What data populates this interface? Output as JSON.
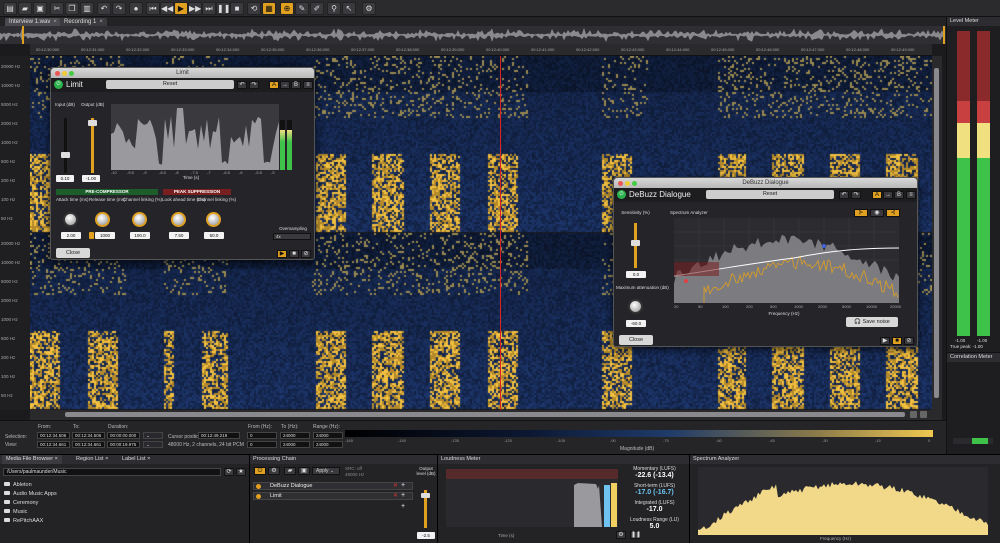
{
  "tabs": [
    {
      "label": "Interview 1.wav"
    },
    {
      "label": "Recording 1"
    }
  ],
  "timeline_ticks": [
    "00:12:30.000",
    "00:12:31.000",
    "00:12:32.000",
    "00:12:33.000",
    "00:12:34.000",
    "00:12:35.000",
    "00:12:36.000",
    "00:12:37.000",
    "00:12:38.000",
    "00:12:39.000",
    "00:12:40.000",
    "00:12:41.000",
    "00:12:42.000",
    "00:12:43.000",
    "00:12:44.000",
    "00:12:45.000",
    "00:12:46.000",
    "00:12:47.000",
    "00:12:48.000",
    "00:12:49.000"
  ],
  "freq_labels": [
    "20000 Hz",
    "10000 Hz",
    "5000 Hz",
    "2000 Hz",
    "1000 Hz",
    "500 Hz",
    "200 Hz",
    "100 Hz",
    "50 Hz"
  ],
  "info": {
    "selection": "Selection:",
    "view": "View:",
    "from_label": "From:",
    "to_label": "To:",
    "duration_label": "Duration:",
    "sel_from": "00:12:34.506",
    "sel_to": "00:12:34.506",
    "sel_dur": "00:00:00.000",
    "view_from": "00:12:34.661",
    "view_to": "00:12:34.661",
    "view_dur": "00:00:19.975",
    "cursor_label": "Cursor position:",
    "cursor_val": "00:12:49.219",
    "format": "48000 Hz, 2 channels, 24 bit PCM",
    "fromhz_label": "From (Hz):",
    "tohz_label": "To (Hz):",
    "range_label": "Range (Hz):",
    "fromhz": "0",
    "tohz": "24000",
    "range": "24000",
    "fromhz2": "0",
    "tohz2": "24000",
    "range2": "24000",
    "mag_label": "Magnitude (dB)"
  },
  "mag_ticks": [
    "-165",
    "-150",
    "-135",
    "-120",
    "-105",
    "-90",
    "-75",
    "-60",
    "-45",
    "-30",
    "-15",
    "0"
  ],
  "level_meter": {
    "title": "Level Meter",
    "peak_l": "-1.00",
    "peak_r": "-1.00",
    "true_peak": "True peak: -1.00"
  },
  "correlation_meter": {
    "title": "Correlation Meter"
  },
  "limit": {
    "window_title": "Limit",
    "name": "Limit",
    "preset": "Reset",
    "input_label": "Input (dB)",
    "output_label": "Output (dB)",
    "input_val": "0.10",
    "output_val": "-1.00",
    "time_label": "Time (s)",
    "pre_comp": "PRE-COMPRESSOR",
    "peak_supp": "PEAK SUPPRESSION",
    "knobs": [
      {
        "label": "Attack time (ms)",
        "value": "2.00"
      },
      {
        "label": "Release time (ms)",
        "value": "1000"
      },
      {
        "label": "Channel linking (%)",
        "value": "100.0"
      },
      {
        "label": "Look ahead time (ms)",
        "value": "7.50"
      },
      {
        "label": "Channel linking (%)",
        "value": "50.0"
      }
    ],
    "oversampling_label": "Oversampling",
    "oversampling_val": "4x",
    "close": "Close",
    "time_ticks": [
      "-10",
      "-9.5",
      "-9",
      "-8.5",
      "-8",
      "-7.5",
      "-7",
      "-6.5",
      "-6",
      "-5.5",
      "-5"
    ]
  },
  "debuzz": {
    "window_title": "DeBuzz Dialogue",
    "name": "DeBuzz Dialogue",
    "preset": "Reset",
    "sensitivity_label": "Sensitivity (%)",
    "sensitivity_val": "0.0",
    "max_att_label": "Maximum attenuation (dB)",
    "max_att_val": "-60.0",
    "analyzer_label": "Spectrum Analyzer",
    "freq_label": "Frequency (Hz)",
    "freq_ticks": [
      "20",
      "50",
      "100",
      "200",
      "500",
      "1000",
      "2000",
      "5000",
      "10000",
      "20000"
    ],
    "save_noise": "Save noise",
    "close": "Close"
  },
  "media_browser": {
    "tab": "Media File Browser",
    "tab2": "Region List",
    "tab3": "Label List",
    "path": "/Users/paulmaunder/Music",
    "items": [
      "Ableton",
      "Audio Music Apps",
      "Ceremony",
      "Music",
      "RePitchAAX"
    ]
  },
  "processing_chain": {
    "title": "Processing Chain",
    "apply": "Apply",
    "src_label": "SRC: off",
    "src_rate": "48000 Hz",
    "output_label": "Output level (dB)",
    "output_val": "-2.5",
    "items": [
      "DeBuzz Dialogue",
      "Limit"
    ]
  },
  "loudness_meter": {
    "title": "Loudness Meter",
    "time_label": "Time (s)",
    "momentary_label": "Momentary (LUFS)",
    "momentary_val": "-22.6 (-13.4)",
    "short_label": "Short-term (LUFS)",
    "short_val": "-17.0 (-16.7)",
    "integrated_label": "Integrated (LUFS)",
    "integrated_val": "-17.0",
    "range_label": "Loudness Range (LU)",
    "range_val": "5.0"
  },
  "spectrum_analyzer": {
    "title": "Spectrum Analyzer",
    "freq_label": "Frequency (Hz)"
  },
  "colors": {
    "accent": "#e0a020",
    "green": "#2bb24c",
    "spectro_bg": "#0d1a33",
    "spectro_hot": "#f0c040"
  }
}
